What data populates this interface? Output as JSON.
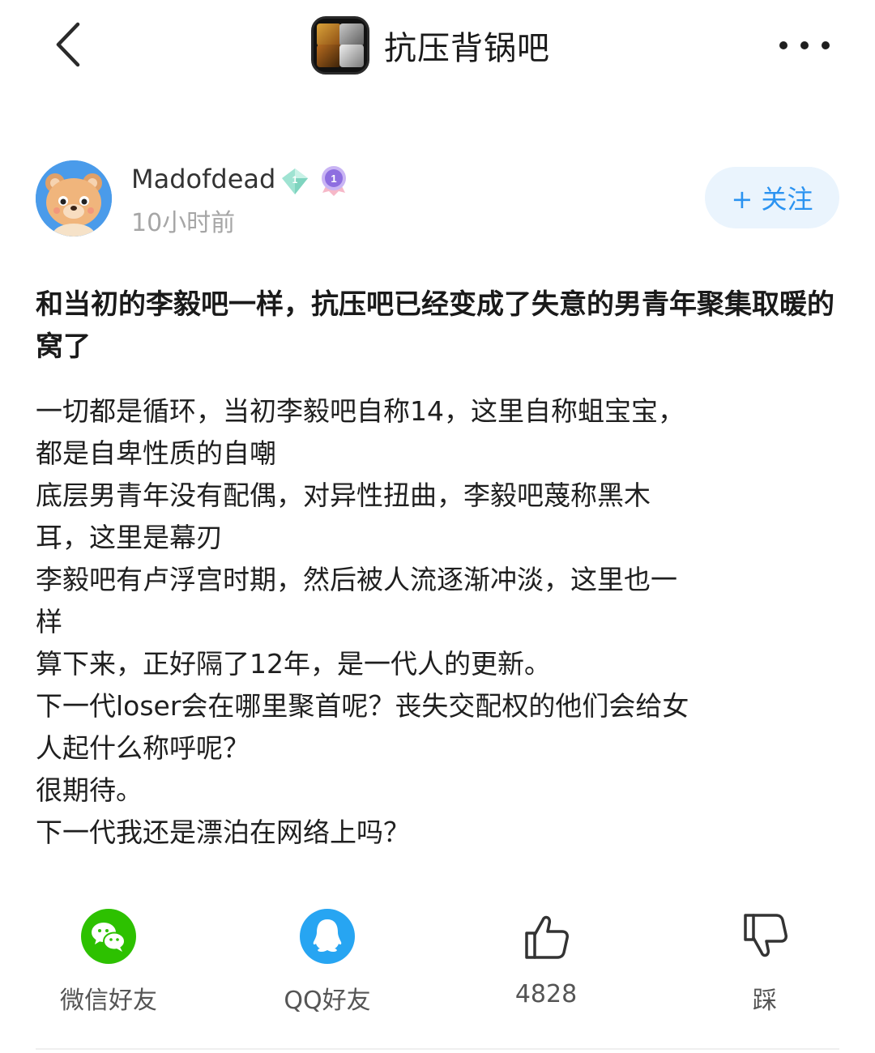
{
  "forum": {
    "name": "抗压背锅吧"
  },
  "author": {
    "name": "Madofdead",
    "level": "1",
    "member_level": "1",
    "time": "10小时前",
    "follow_label": "+ 关注"
  },
  "post": {
    "title": "和当初的李毅吧一样，抗压吧已经变成了失意的男青年聚集取暖的窝了",
    "body_lines": [
      "一切都是循环，当初李毅吧自称14，这里自称蛆宝宝，",
      "都是自卑性质的自嘲",
      "底层男青年没有配偶，对异性扭曲，李毅吧蔑称黑木",
      "耳，这里是幕刃",
      "李毅吧有卢浮宫时期，然后被人流逐渐冲淡，这里也一",
      "样",
      "算下来，正好隔了12年，是一代人的更新。",
      "下一代loser会在哪里聚首呢？丧失交配权的他们会给女",
      "人起什么称呼呢？",
      "很期待。",
      "下一代我还是漂泊在网络上吗？"
    ]
  },
  "actions": {
    "wechat_label": "微信好友",
    "qq_label": "QQ好友",
    "like_count": "4828",
    "dislike_label": "踩"
  },
  "colors": {
    "accent": "#2b93f1",
    "wechat": "#2dc100",
    "qq": "#27a5f2",
    "muted_text": "#a6a6a6"
  },
  "icons": {
    "back": "chevron-left-icon",
    "more": "more-dots-icon",
    "level_badge": "diamond-level-icon",
    "member_badge": "member-medal-icon",
    "wechat": "wechat-icon",
    "qq": "qq-penguin-icon",
    "like": "thumbs-up-icon",
    "dislike": "thumbs-down-icon"
  }
}
